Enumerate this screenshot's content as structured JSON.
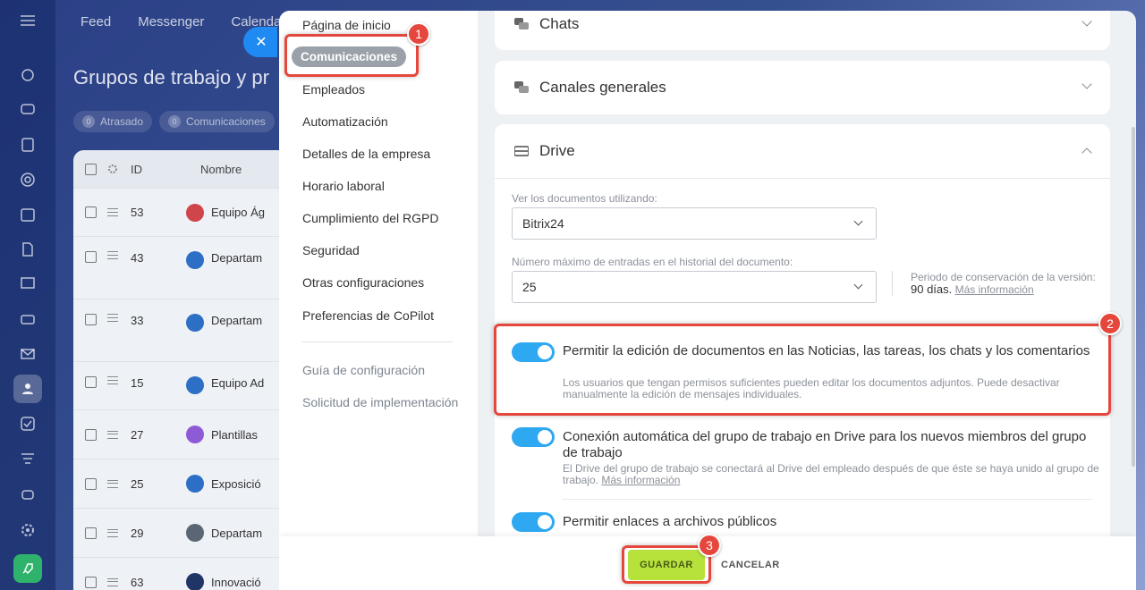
{
  "background": {
    "topnav": [
      "Feed",
      "Messenger",
      "Calendario"
    ],
    "page_title": "Grupos de trabajo y pr",
    "filters": [
      {
        "count": "0",
        "label": "Atrasado"
      },
      {
        "count": "0",
        "label": "Comunicaciones"
      }
    ],
    "table": {
      "col_id": "ID",
      "col_name": "Nombre",
      "rows": [
        {
          "id": "53",
          "name": "Equipo Ág",
          "color": "#d0444b"
        },
        {
          "id": "43",
          "name": "Departam",
          "color": "#2d6fc5"
        },
        {
          "id": "33",
          "name": "Departam",
          "color": "#2d6fc5"
        },
        {
          "id": "15",
          "name": "Equipo Ad",
          "color": "#2d6fc5"
        },
        {
          "id": "27",
          "name": "Plantillas",
          "color": "#8e5bd6"
        },
        {
          "id": "25",
          "name": "Exposició",
          "color": "#2d6fc5"
        },
        {
          "id": "29",
          "name": "Departam",
          "color": "#5a6673"
        },
        {
          "id": "63",
          "name": "Innovació",
          "color": "#1f3566"
        }
      ]
    }
  },
  "settings_menu": {
    "items": [
      "Página de inicio",
      "Comunicaciones",
      "Empleados",
      "Automatización",
      "Detalles de la empresa",
      "Horario laboral",
      "Cumplimiento del RGPD",
      "Seguridad",
      "Otras configuraciones",
      "Preferencias de CoPilot"
    ],
    "active": "Comunicaciones",
    "secondary": [
      "Guía de configuración",
      "Solicitud de implementación"
    ]
  },
  "sections": {
    "chats": "Chats",
    "canales": "Canales generales",
    "drive": "Drive"
  },
  "drive": {
    "view_label": "Ver los documentos utilizando:",
    "view_value": "Bitrix24",
    "history_label": "Número máximo de entradas en el historial del documento:",
    "history_value": "25",
    "retention_label": "Periodo de conservación de la versión:",
    "retention_value": "90 días.",
    "retention_link": "Más información",
    "options": [
      {
        "title": "Permitir la edición de documentos en las Noticias, las tareas, los chats y los comentarios",
        "desc": "Los usuarios que tengan permisos suficientes pueden editar los documentos adjuntos. Puede desactivar manualmente la edición de mensajes individuales.",
        "enabled": true
      },
      {
        "title": "Conexión automática del grupo de trabajo en Drive para los nuevos miembros del grupo de trabajo",
        "desc": "El Drive del grupo de trabajo se conectará al Drive del empleado después de que éste se haya unido al grupo de trabajo.",
        "link": "Más información",
        "enabled": true
      },
      {
        "title": "Permitir enlaces a archivos públicos",
        "enabled": true
      }
    ]
  },
  "footer": {
    "save": "GUARDAR",
    "cancel": "CANCELAR"
  },
  "annotations": [
    "1",
    "2",
    "3"
  ],
  "colors": {
    "accent": "#2fa8f2",
    "save": "#b7e23b",
    "highlight": "#e5473d"
  }
}
